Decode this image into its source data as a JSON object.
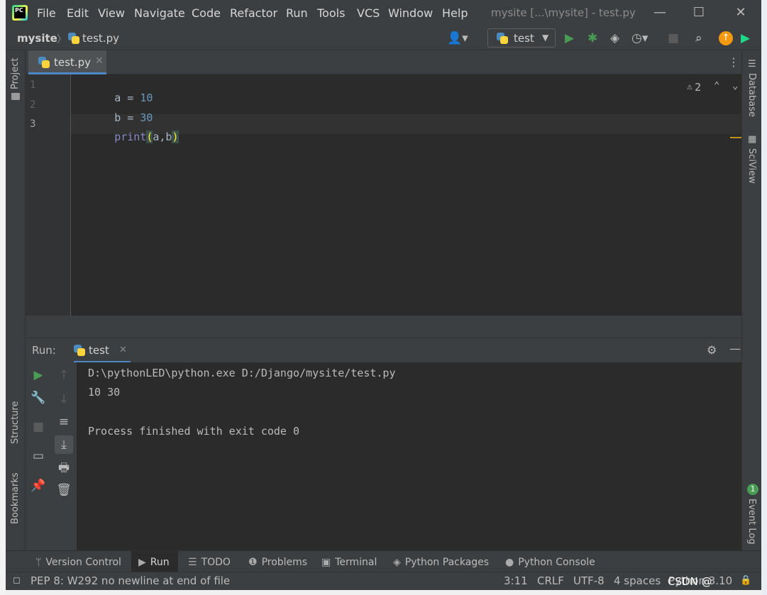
{
  "window": {
    "title": "mysite [...\\mysite] - test.py",
    "app_icon_label": "PC",
    "menu": [
      "File",
      "Edit",
      "View",
      "Navigate",
      "Code",
      "Refactor",
      "Run",
      "Tools",
      "VCS",
      "Window",
      "Help"
    ]
  },
  "navbar": {
    "project": "mysite",
    "separator": "〉",
    "file": "test.py",
    "run_config": "test"
  },
  "left_tabs": {
    "project": "Project",
    "structure": "Structure",
    "bookmarks": "Bookmarks"
  },
  "right_tabs": {
    "database": "Database",
    "sciview": "SciView",
    "event_log": "Event Log",
    "event_count": "1"
  },
  "editor": {
    "tab": "test.py",
    "warnings": "2",
    "line_numbers": [
      "1",
      "2",
      "3"
    ],
    "lines": {
      "l1": {
        "var": "a",
        "op": " = ",
        "num": "10"
      },
      "l2": {
        "var": "b",
        "op": " = ",
        "num": "30"
      },
      "l3": {
        "fn": "print",
        "open": "(",
        "args": "a,b",
        "close": ")"
      }
    }
  },
  "run_panel": {
    "label": "Run:",
    "tab": "test",
    "output": [
      "D:\\pythonLED\\python.exe D:/Django/mysite/test.py",
      "10 30",
      "",
      "Process finished with exit code 0"
    ]
  },
  "bottom_tabs": [
    "Version Control",
    "Run",
    "TODO",
    "Problems",
    "Terminal",
    "Python Packages",
    "Python Console"
  ],
  "status": {
    "message": "PEP 8: W292 no newline at end of file",
    "position": "3:11",
    "line_sep": "CRLF",
    "encoding": "UTF-8",
    "indent": "4 spaces",
    "interpreter": "Python 3.10",
    "watermark": "CSDN @"
  },
  "colors": {
    "accent": "#4a88c7",
    "run_green": "#499c54",
    "keyword": "#8888c6",
    "number": "#6897bb"
  },
  "icons": [
    "pycharm-logo-icon",
    "python-file-icon",
    "user-icon",
    "run-icon",
    "debug-icon",
    "coverage-icon",
    "profile-icon",
    "stop-icon",
    "search-icon",
    "update-icon",
    "gear-icon",
    "minimize-icon",
    "wrench-icon",
    "soft-wrap-icon",
    "scroll-to-end-icon",
    "print-icon",
    "trash-icon",
    "pin-icon",
    "layout-icon",
    "warning-icon"
  ]
}
